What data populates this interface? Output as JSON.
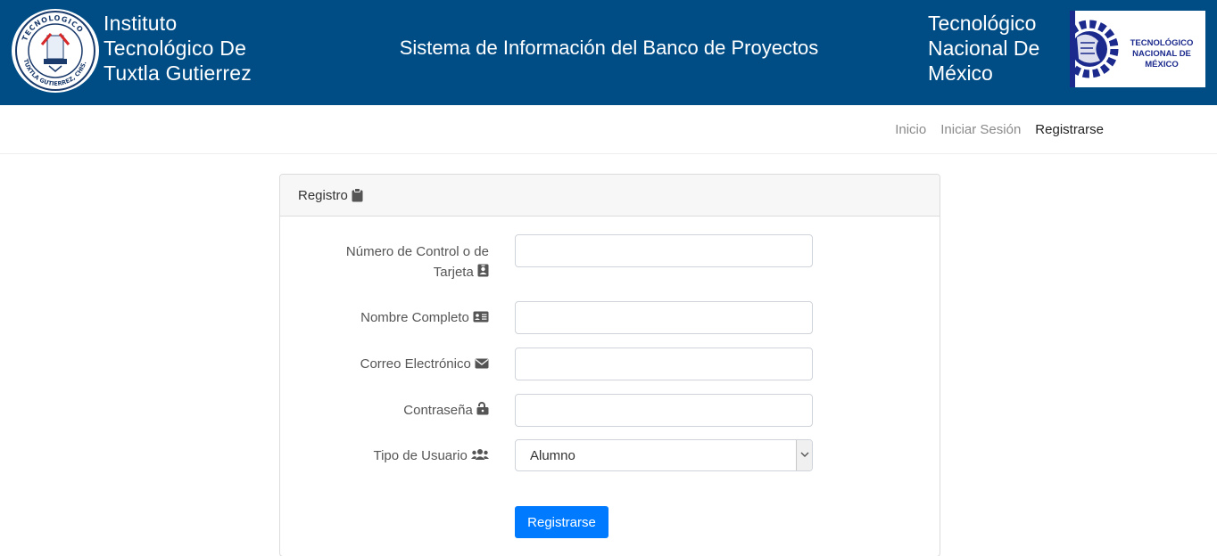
{
  "header": {
    "institute_name_lines": [
      "Instituto",
      "Tecnológico De",
      "Tuxtla Gutierrez"
    ],
    "institute_logo_text": "TECNOLÓGICO · TUXTLA GUTIERREZ, CHIS.",
    "system_title": "Sistema de Información del Banco de Proyectos",
    "tecnm_name_lines": [
      "Tecnológico",
      "Nacional De",
      "México"
    ],
    "tecnm_logo_text_lines": [
      "TECNOLÓGICO",
      "NACIONAL DE MÉXICO"
    ],
    "background_color": "#004d86"
  },
  "nav": {
    "items": [
      {
        "label": "Inicio",
        "active": false
      },
      {
        "label": "Iniciar Sesión",
        "active": false
      },
      {
        "label": "Registrarse",
        "active": true
      }
    ]
  },
  "form": {
    "title": "Registro",
    "title_icon": "clipboard-icon",
    "fields": [
      {
        "label_lines": [
          "Número de Control o de",
          "Tarjeta"
        ],
        "icon": "id-badge-icon",
        "value": ""
      },
      {
        "label_lines": [
          "Nombre Completo"
        ],
        "icon": "id-card-icon",
        "value": ""
      },
      {
        "label_lines": [
          "Correo Electrónico"
        ],
        "icon": "envelope-icon",
        "value": ""
      },
      {
        "label_lines": [
          "Contraseña"
        ],
        "icon": "unlock-icon",
        "value": ""
      }
    ],
    "user_type": {
      "label": "Tipo de Usuario",
      "icon": "users-icon",
      "selected": "Alumno"
    },
    "submit_label": "Registrarse",
    "accent_color": "#007bff"
  }
}
